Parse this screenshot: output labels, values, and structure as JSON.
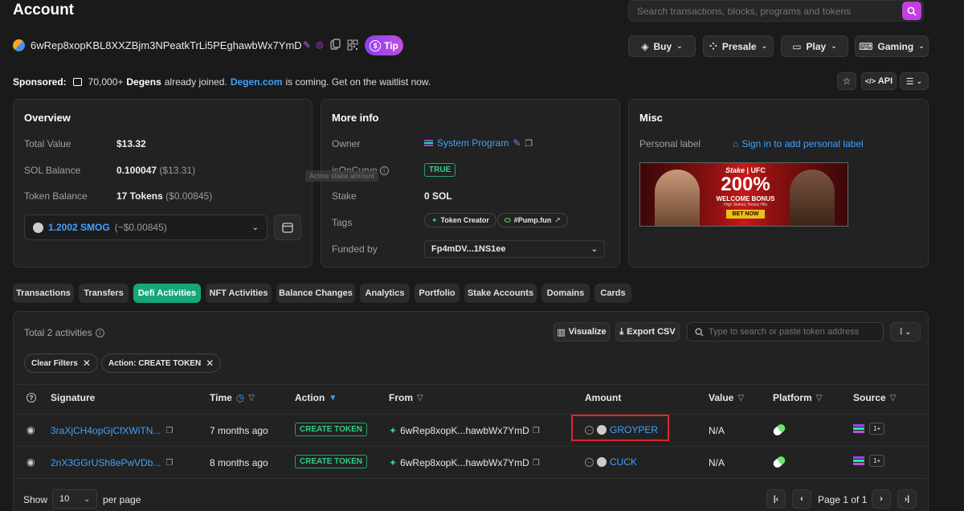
{
  "header": {
    "title": "Account",
    "search_placeholder": "Search transactions, blocks, programs and tokens",
    "address": "6wRep8xopKBL8XXZBjm3NPeatkTrLi5PEghawbWx7YmD",
    "tip_label": "Tip",
    "nav": [
      {
        "label": "Buy"
      },
      {
        "label": "Presale"
      },
      {
        "label": "Play"
      },
      {
        "label": "Gaming"
      }
    ]
  },
  "sponsored": {
    "prefix": "Sponsored:",
    "count_text": "70,000+",
    "bold_word": "Degens",
    "text1": "already joined.",
    "link": "Degen.com",
    "text2": "is coming. Get on the waitlist now.",
    "api_label": "API"
  },
  "overview": {
    "title": "Overview",
    "total_value_label": "Total Value",
    "total_value": "$13.32",
    "sol_balance_label": "SOL Balance",
    "sol_balance": "0.100047",
    "sol_balance_usd": "($13.31)",
    "token_balance_label": "Token Balance",
    "token_balance": "17 Tokens",
    "token_balance_usd": "($0.00845)",
    "token_select": "1.2002 SMOG",
    "token_select_usd": "(~$0.00845)"
  },
  "more_info": {
    "title": "More info",
    "owner_label": "Owner",
    "owner_value": "System Program",
    "is_on_curve_label": "isOnCurve",
    "is_on_curve_value": "TRUE",
    "tooltip": "Active stake amount",
    "stake_label": "Stake",
    "stake_value": "0 SOL",
    "tags_label": "Tags",
    "tag1": "Token Creator",
    "tag2": "#Pump.fun",
    "funded_by_label": "Funded by",
    "funded_by_value": "Fp4mDV...1NS1ee"
  },
  "misc": {
    "title": "Misc",
    "personal_label": "Personal label",
    "sign_in_text": "Sign in to add personal label",
    "ad": {
      "brand1": "Stake",
      "brand2": "UFC",
      "big": "200%",
      "sub": "WELCOME BONUS",
      "tiny": "High Stakes, Heavy Hits",
      "cta": "BET NOW"
    }
  },
  "tabs": [
    {
      "label": "Transactions"
    },
    {
      "label": "Transfers"
    },
    {
      "label": "Defi Activities"
    },
    {
      "label": "NFT Activities"
    },
    {
      "label": "Balance Changes"
    },
    {
      "label": "Analytics"
    },
    {
      "label": "Portfolio"
    },
    {
      "label": "Stake Accounts"
    },
    {
      "label": "Domains"
    },
    {
      "label": "Cards"
    }
  ],
  "activities": {
    "total_text": "Total 2 activities",
    "visualize_label": "Visualize",
    "export_label": "Export CSV",
    "token_search_placeholder": "Type to search or paste token address",
    "filter_clear": "Clear Filters",
    "filter_action": "Action: CREATE TOKEN",
    "columns": {
      "signature": "Signature",
      "time": "Time",
      "action": "Action",
      "from": "From",
      "amount": "Amount",
      "value": "Value",
      "platform": "Platform",
      "source": "Source"
    },
    "rows": [
      {
        "signature": "3raXjCH4opGjCfXWiTN...",
        "time": "7 months ago",
        "action": "CREATE TOKEN",
        "from": "6wRep8xopK...hawbWx7YmD",
        "amount": "GROYPER",
        "value": "N/A",
        "source_extra": "1+"
      },
      {
        "signature": "2nX3GGrUSh8ePwVDb...",
        "time": "8 months ago",
        "action": "CREATE TOKEN",
        "from": "6wRep8xopK...hawbWx7YmD",
        "amount": "CUCK",
        "value": "N/A",
        "source_extra": "1+"
      }
    ]
  },
  "pagination": {
    "show_label": "Show",
    "page_size": "10",
    "per_page_label": "per page",
    "page_text": "Page 1 of 1"
  },
  "colors": {
    "accent_green": "#17a57a",
    "link_blue": "#3ea2ff",
    "tip_purple": "#8b3ff0",
    "highlight_red": "#e0252b"
  }
}
